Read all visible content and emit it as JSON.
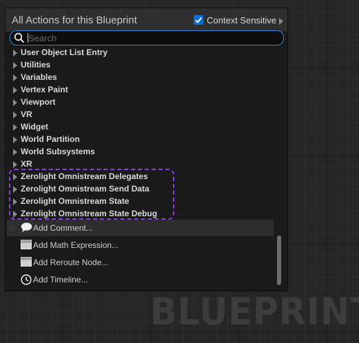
{
  "watermark": "BLUEPRINT",
  "panel": {
    "title": "All Actions for this Blueprint",
    "context_sensitive": {
      "label": "Context Sensitive",
      "checked": true
    },
    "search": {
      "placeholder": "Search",
      "value": ""
    }
  },
  "categories": [
    "User Object List Entry",
    "Utilities",
    "Variables",
    "Vertex Paint",
    "Viewport",
    "VR",
    "Widget",
    "World Partition",
    "World Subsystems",
    "XR",
    "Zerolight Omnistream Delegates",
    "Zerolight Omnistream Send Data",
    "Zerolight Omnistream State",
    "Zerolight Omnistream State Debug"
  ],
  "highlighted_categories": [
    "Zerolight Omnistream Delegates",
    "Zerolight Omnistream Send Data",
    "Zerolight Omnistream State",
    "Zerolight Omnistream State Debug"
  ],
  "actions": [
    {
      "label": "Add Comment...",
      "icon": "comment-icon",
      "selected": true
    },
    {
      "label": "Add Math Expression...",
      "icon": "node-icon",
      "selected": false
    },
    {
      "label": "Add Reroute Node...",
      "icon": "node-icon",
      "selected": false
    },
    {
      "label": "Add Timeline...",
      "icon": "clock-icon",
      "selected": false
    }
  ],
  "colors": {
    "accent_blue": "#2a86e0",
    "highlight_purple": "#8a3fe0",
    "panel_bg": "#1a1a1a"
  }
}
